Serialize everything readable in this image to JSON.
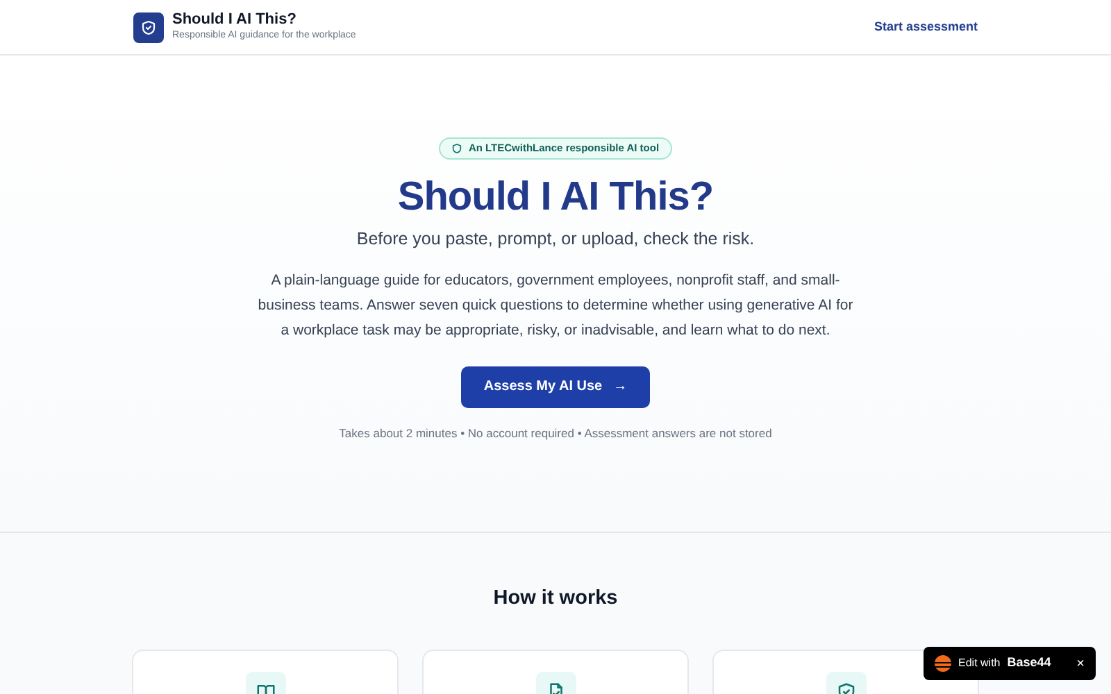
{
  "header": {
    "title": "Should I AI This?",
    "subtitle": "Responsible AI guidance for the workplace",
    "nav_link": "Start assessment"
  },
  "hero": {
    "badge": "An LTECwithLance responsible AI tool",
    "title": "Should I AI This?",
    "tagline": "Before you paste, prompt, or upload, check the risk.",
    "description": "A plain-language guide for educators, government employees, nonprofit staff, and small-business teams. Answer seven quick questions to determine whether using generative AI for a workplace task may be appropriate, risky, or inadvisable, and learn what to do next.",
    "button": "Assess My AI Use",
    "arrow": "→",
    "note": "Takes about 2 minutes • No account required • Assessment answers are not stored"
  },
  "how_it_works": {
    "title": "How it works",
    "cards": [
      {
        "kind": "book"
      },
      {
        "kind": "file-check"
      },
      {
        "kind": "shield-check"
      }
    ]
  },
  "widget": {
    "label": "Edit with",
    "brand": "Base44",
    "close": "×"
  }
}
